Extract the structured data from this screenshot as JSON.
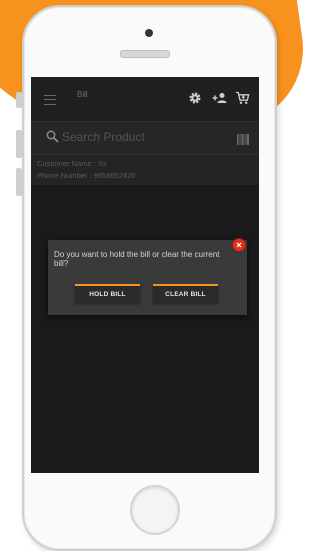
{
  "app": {
    "title": "Bill"
  },
  "toolbar": {
    "icons": [
      "menu-icon",
      "gear-icon",
      "add-user-icon",
      "cart-icon"
    ]
  },
  "search": {
    "placeholder": "Search Product",
    "icon": "search-icon",
    "barcode_icon": "barcode-icon"
  },
  "customer": {
    "name_line": "Customer Name : Xs",
    "phone_line": "Phone Number : 9658652420"
  },
  "dialog": {
    "message": "Do you want to hold the bill or clear the current bill?",
    "hold_label": "HOLD BILL",
    "clear_label": "CLEAR BILL",
    "close_icon": "close-icon"
  },
  "colors": {
    "accent": "#f7921e",
    "close": "#e0301e",
    "screen_bg": "#1a1a1a",
    "dialog_bg": "#3a3a3a"
  }
}
